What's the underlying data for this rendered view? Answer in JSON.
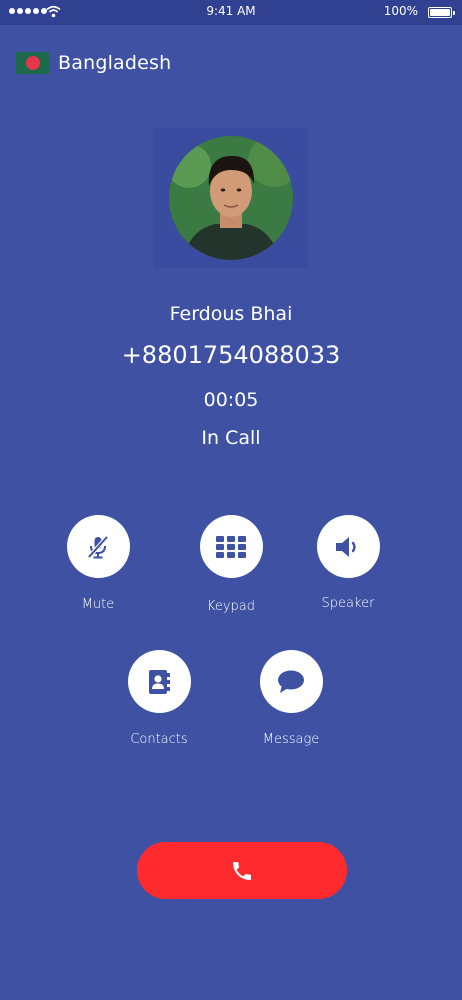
{
  "status_bar": {
    "time": "9:41 AM",
    "battery_percent": "100%",
    "signal_icon": "signal-dots-icon",
    "wifi_icon": "wifi-icon",
    "battery_icon": "battery-icon"
  },
  "country": {
    "name": "Bangladesh",
    "flag_icon": "bangladesh-flag-icon"
  },
  "caller": {
    "name": "Ferdous Bhai",
    "number": "+8801754088033",
    "timer": "00:05",
    "status": "In Call"
  },
  "actions": [
    {
      "label": "Mute",
      "icon": "muted-mic-icon"
    },
    {
      "label": "Keypad",
      "icon": "keypad-icon"
    },
    {
      "label": "Speaker",
      "icon": "speaker-icon"
    },
    {
      "label": "Contacts",
      "icon": "contacts-book-icon"
    },
    {
      "label": "Message",
      "icon": "chat-bubble-icon"
    }
  ],
  "end_call": {
    "icon": "phone-handset-icon"
  },
  "colors": {
    "background": "#3F51A3",
    "status_bar": "#2F4190",
    "accent": "#3F51A3",
    "end_call": "#FF2A2E"
  }
}
